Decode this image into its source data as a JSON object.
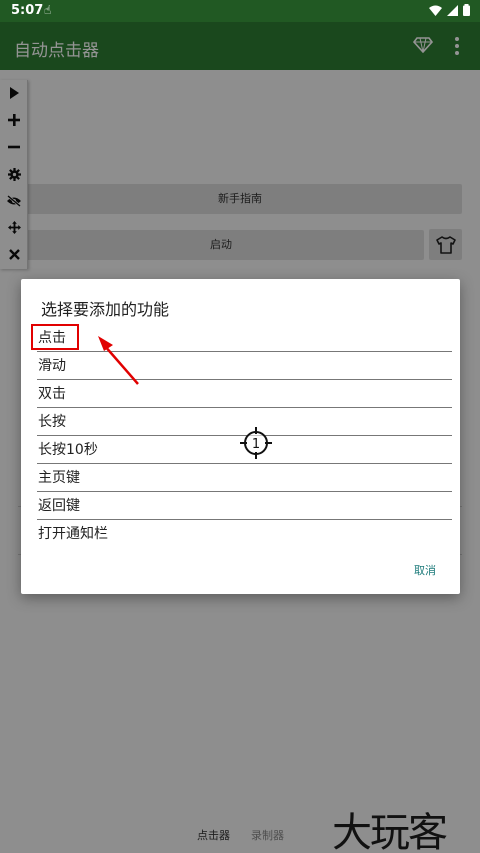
{
  "status_bar": {
    "time": "5:07"
  },
  "app_bar": {
    "title": "自动点击器"
  },
  "main": {
    "guide_button": "新手指南",
    "start_button": "启动"
  },
  "toolbar": {
    "icons": [
      "play-icon",
      "plus-icon",
      "minus-icon",
      "gear-icon",
      "eye-off-icon",
      "move-icon",
      "close-icon"
    ]
  },
  "dialog": {
    "title": "选择要添加的功能",
    "options": [
      "点击",
      "滑动",
      "双击",
      "长按",
      "长按10秒",
      "主页键",
      "返回键",
      "打开通知栏"
    ],
    "cancel": "取消"
  },
  "target": {
    "number": "1"
  },
  "bottom_nav": {
    "tab_clicker": "点击器",
    "tab_recorder": "录制器"
  },
  "watermark": "大玩客",
  "colors": {
    "app_bar": "#2e7d32",
    "status_bar": "#215923",
    "highlight": "#e10000",
    "accent": "#1b7a7a"
  }
}
